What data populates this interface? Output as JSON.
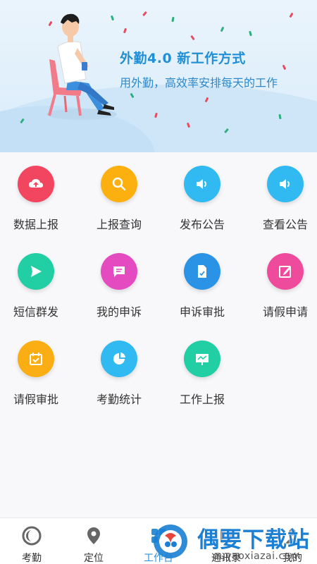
{
  "banner": {
    "title": "外勤4.0  新工作方式",
    "subtitle": "用外勤，高效率安排每天的工作"
  },
  "tiles": [
    {
      "label": "数据上报",
      "icon": "cloud-upload-icon",
      "color": "#f2455f"
    },
    {
      "label": "上报查询",
      "icon": "search-icon",
      "color": "#fbb010"
    },
    {
      "label": "发布公告",
      "icon": "speaker-icon",
      "color": "#31b9f1"
    },
    {
      "label": "查看公告",
      "icon": "speaker-icon",
      "color": "#31b9f1"
    },
    {
      "label": "短信群发",
      "icon": "send-icon",
      "color": "#22cfa5"
    },
    {
      "label": "我的申诉",
      "icon": "message-icon",
      "color": "#e54bc0"
    },
    {
      "label": "申诉审批",
      "icon": "document-check-icon",
      "color": "#2a93e6"
    },
    {
      "label": "请假申请",
      "icon": "edit-icon",
      "color": "#ef4b9c"
    },
    {
      "label": "请假审批",
      "icon": "calendar-check-icon",
      "color": "#fbae14"
    },
    {
      "label": "考勤统计",
      "icon": "pie-chart-icon",
      "color": "#31b9f1"
    },
    {
      "label": "工作上报",
      "icon": "presentation-icon",
      "color": "#22cfa5"
    }
  ],
  "nav": [
    {
      "label": "考勤",
      "icon": "clock-icon"
    },
    {
      "label": "定位",
      "icon": "location-pin-icon"
    },
    {
      "label": "工作台",
      "icon": "dashboard-icon"
    },
    {
      "label": "通讯录",
      "icon": "contacts-icon"
    },
    {
      "label": "我的",
      "icon": "person-icon"
    }
  ],
  "watermark": {
    "text": "偶要下载站",
    "url": "ouyaoxiazai.com"
  },
  "colors": {
    "accent": "#2f8fd6",
    "banner_text": "#1f8fd7"
  }
}
